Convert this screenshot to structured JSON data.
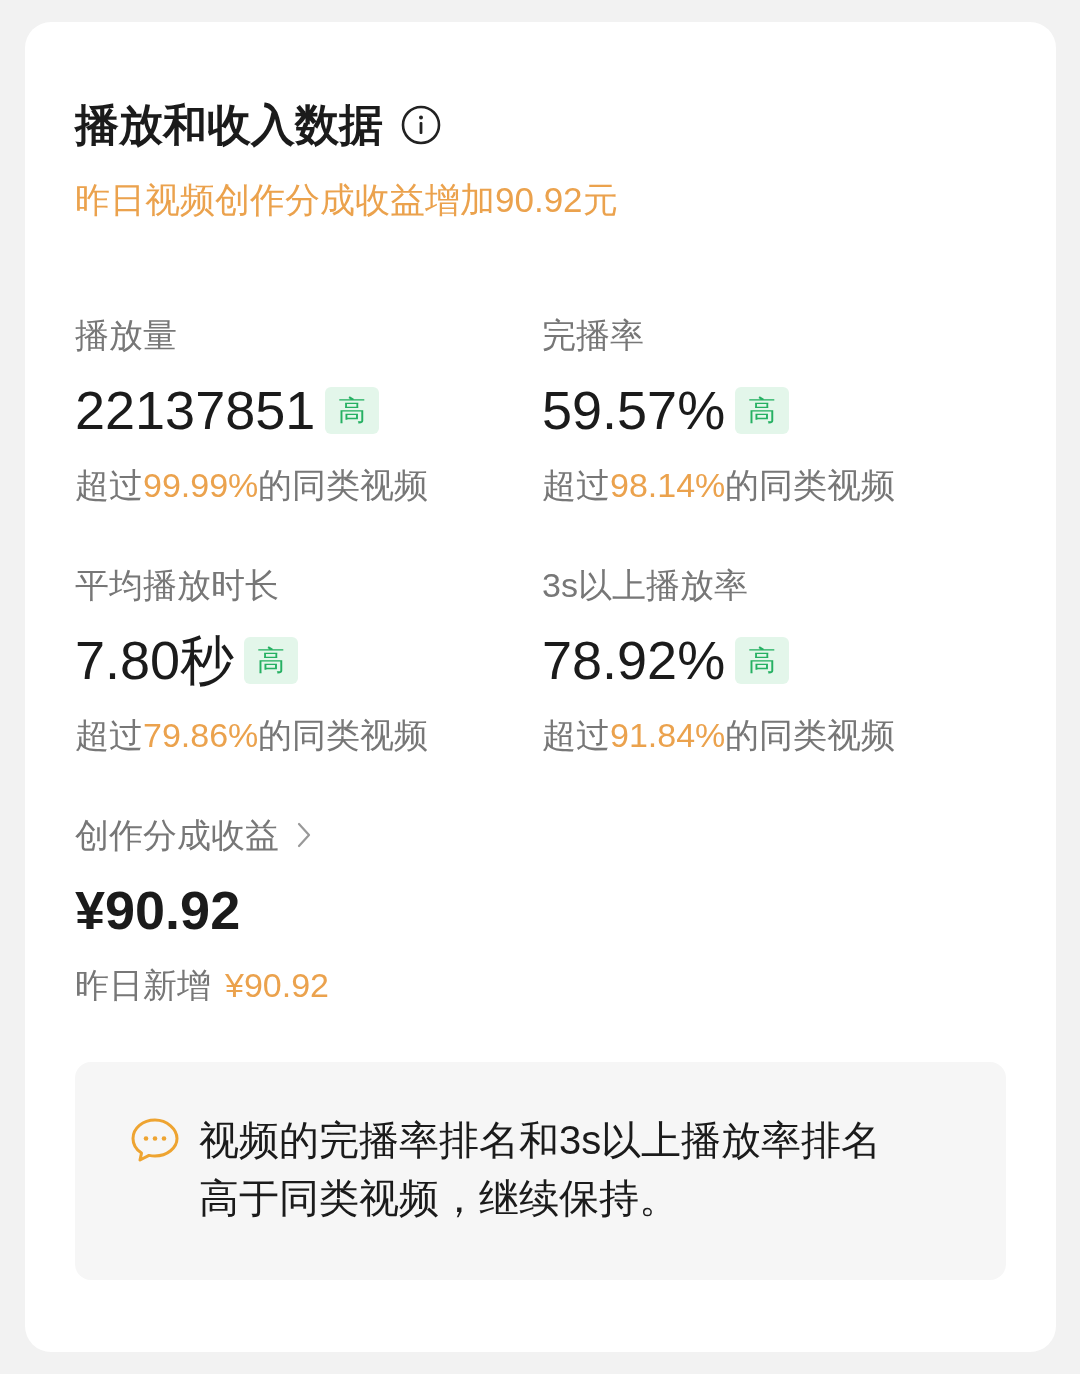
{
  "card": {
    "title": "播放和收入数据",
    "subtitle": "昨日视频创作分成收益增加90.92元",
    "metrics": [
      {
        "label": "播放量",
        "value": "22137851",
        "badge": "高",
        "comparison": {
          "prefix": "超过",
          "percent": "99.99%",
          "suffix": "的同类视频"
        }
      },
      {
        "label": "完播率",
        "value": "59.57%",
        "badge": "高",
        "comparison": {
          "prefix": "超过",
          "percent": "98.14%",
          "suffix": "的同类视频"
        }
      },
      {
        "label": "平均播放时长",
        "value": "7.80秒",
        "badge": "高",
        "comparison": {
          "prefix": "超过",
          "percent": "79.86%",
          "suffix": "的同类视频"
        }
      },
      {
        "label": "3s以上播放率",
        "value": "78.92%",
        "badge": "高",
        "comparison": {
          "prefix": "超过",
          "percent": "91.84%",
          "suffix": "的同类视频"
        }
      }
    ],
    "revenue": {
      "label": "创作分成收益",
      "value": "¥90.92",
      "yesterday_label": "昨日新增",
      "yesterday_value": "¥90.92"
    },
    "tip": {
      "text": "视频的完播率排名和3s以上播放率排名高于同类视频，继续保持。"
    }
  }
}
